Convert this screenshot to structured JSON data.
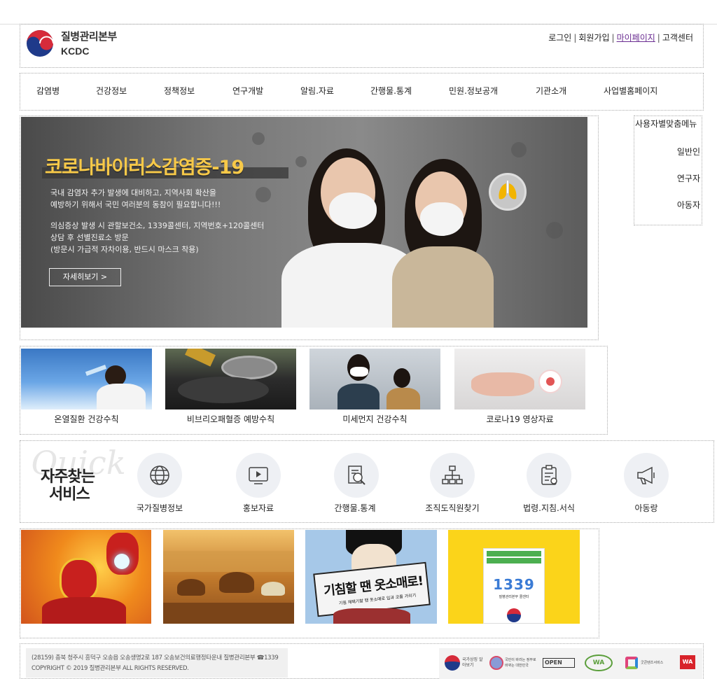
{
  "header": {
    "logo_kr": "질병관리본부",
    "logo_en": "KCDC",
    "util": [
      "로그인",
      "회원가입",
      "마이페이지",
      "고객센터"
    ]
  },
  "gnb": [
    "감염병",
    "건강정보",
    "정책정보",
    "연구개발",
    "알림.자료",
    "간행물.통계",
    "민원.정보공개",
    "기관소개",
    "사업별홈페이지"
  ],
  "hero": {
    "title": "코로나바이러스감염증-19",
    "p1": "국내 감염자 추가 발생에 대비하고, 지역사회 확산을",
    "p2": "예방하기 위해서 국민 여러분의 동참이 필요합니다!!!",
    "p3": "의심증상 발생 시 관할보건소, 1339콜센터, 지역번호+120콜센터",
    "p4": "상담 후 선별진료소 방문",
    "p5": "(방문시 가급적 자차이용, 반드시 마스크 착용)",
    "button": "자세히보기  >"
  },
  "user_menu": {
    "title": "사용자별맞춤메뉴",
    "items": [
      "일반인",
      "연구자",
      "아동자"
    ]
  },
  "campaigns": [
    "온열질환 건강수칙",
    "비브리오패혈증 예방수칙",
    "미세먼지 건강수칙",
    "코로나19 영상자료"
  ],
  "quick": {
    "bg_text": "Quick",
    "title_1": "자주찾는",
    "title_2": "서비스",
    "items": [
      "국가질병정보",
      "홍보자료",
      "간행물.통계",
      "조직도직원찾기",
      "법령.지침.서식",
      "아동랑"
    ]
  },
  "banners": {
    "banner3_text": "기침할 땐 옷소매로!",
    "banner3_sub": "기침 재채기할 땐 옷소매로 입과 코를 가리기",
    "banner4_text": "1339",
    "banner4_sub": "질병관리본부 콜센터"
  },
  "footer": {
    "address": "(28159) 충북 청주시 흥덕구 오송읍 오송생명2로 187 오송보건의료행정타운내 질병관리본부 ☎1339",
    "copyright": "COPYRIGHT © 2019 질병관리본부 ALL RIGHTS RESERVED.",
    "logos": [
      "국가상징 알아보기",
      "국민이 바라는 정부로 바뀌는 대한민국",
      "OPEN",
      "WA",
      "굿콘텐츠서비스",
      "WA"
    ]
  },
  "colors": {
    "accent": "#f7c948",
    "mypage": "#6a2c91",
    "logo_red": "#d62b3a",
    "logo_blue": "#1f3a8a"
  }
}
